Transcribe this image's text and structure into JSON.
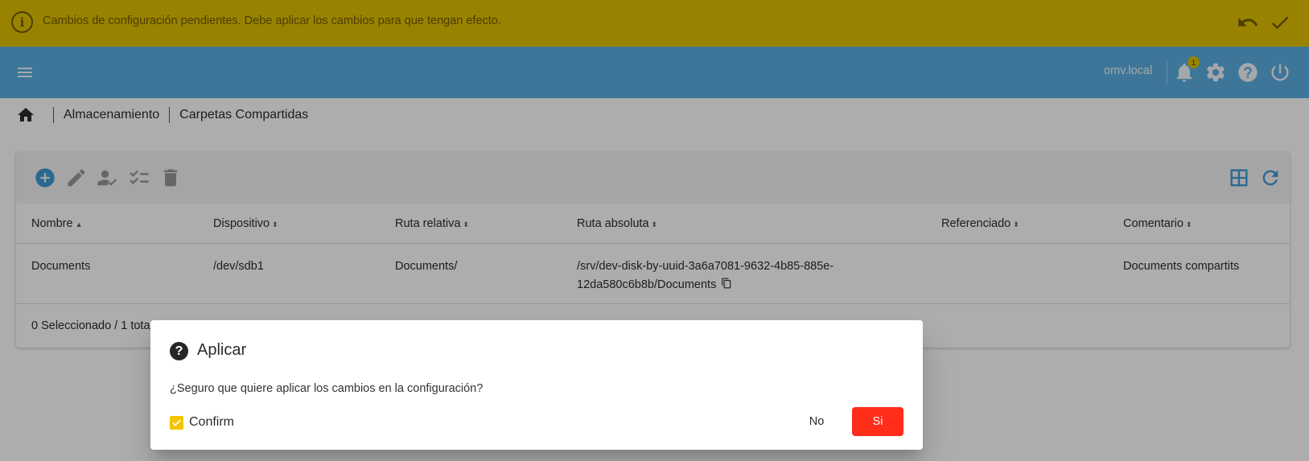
{
  "banner": {
    "message": "Cambios de configuración pendientes. Debe aplicar los cambios para que tengan efecto.",
    "icon": "info-circle-icon"
  },
  "header": {
    "hostname": "omv.local",
    "notification_count": "1"
  },
  "breadcrumb": {
    "items": [
      "Almacenamiento",
      "Carpetas Compartidas"
    ]
  },
  "table": {
    "columns": [
      {
        "label": "Nombre",
        "sort": "▲"
      },
      {
        "label": "Dispositivo",
        "sort": "⬍"
      },
      {
        "label": "Ruta relativa",
        "sort": "⬍"
      },
      {
        "label": "Ruta absoluta",
        "sort": "⬍"
      },
      {
        "label": "Referenciado",
        "sort": "⬍"
      },
      {
        "label": "Comentario",
        "sort": "⬍"
      }
    ],
    "rows": [
      {
        "nombre": "Documents",
        "dispositivo": "/dev/sdb1",
        "ruta_relativa": "Documents/",
        "ruta_absoluta_1": "/srv/dev-disk-by-uuid-3a6a7081-9632-4b85-885e-",
        "ruta_absoluta_2": "12da580c6b8b/Documents",
        "referenciado": "",
        "comentario": "Documents compartits"
      }
    ],
    "footer": "0 Seleccionado / 1 tota"
  },
  "dialog": {
    "title": "Aplicar",
    "message": "¿Seguro que quiere aplicar los cambios en la configuración?",
    "confirm_label": "Confirm",
    "no_label": "No",
    "yes_label": "Si"
  },
  "colors": {
    "banner": "#e2c000",
    "header": "#5aaee0",
    "yes_button": "#ff2d1a",
    "checkbox": "#f4c400"
  }
}
